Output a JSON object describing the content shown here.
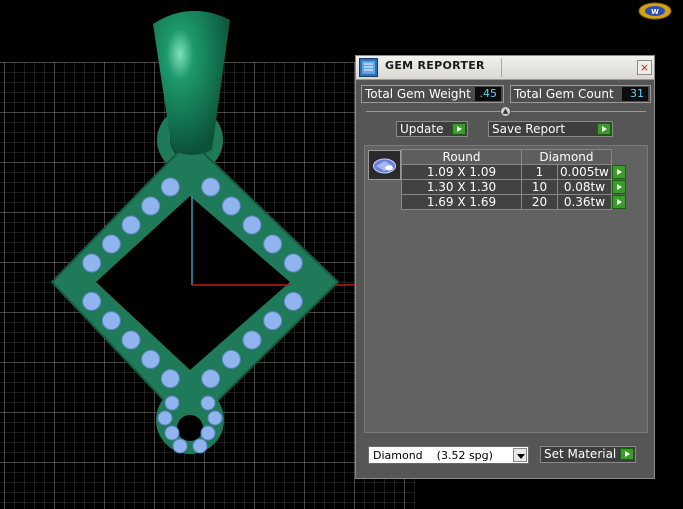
{
  "panel": {
    "title": "GEM REPORTER",
    "close_glyph": "×",
    "total_weight_label": "Total Gem Weight",
    "total_weight_value": ".45",
    "total_count_label": "Total Gem Count",
    "total_count_value": "31",
    "update_label": "Update",
    "save_report_label": "Save Report",
    "table": {
      "headers": [
        "Round",
        "Diamond"
      ],
      "rows": [
        {
          "size": "1.09 X 1.09",
          "count": "1",
          "weight": "0.005tw"
        },
        {
          "size": "1.30 X 1.30",
          "count": "10",
          "weight": "0.08tw"
        },
        {
          "size": "1.69 X 1.69",
          "count": "20",
          "weight": "0.36tw"
        }
      ]
    },
    "material": {
      "name": "Diamond",
      "spg": "(3.52 spg)"
    },
    "set_material_label": "Set Material"
  },
  "icons": {
    "title_icon": "gem-reporter-icon",
    "gem_thumb": "round-gem-icon",
    "arrow": "green-play-arrow-icon"
  },
  "colors": {
    "model_green": "#1f7a5a",
    "gem_blue": "#8fb4ee",
    "grid": "#6a6a6a",
    "axis_x": "#c01818",
    "axis_y": "#2a9ab8",
    "accent_green": "#3a9c2a",
    "value_cyan": "#5ad0ff"
  }
}
